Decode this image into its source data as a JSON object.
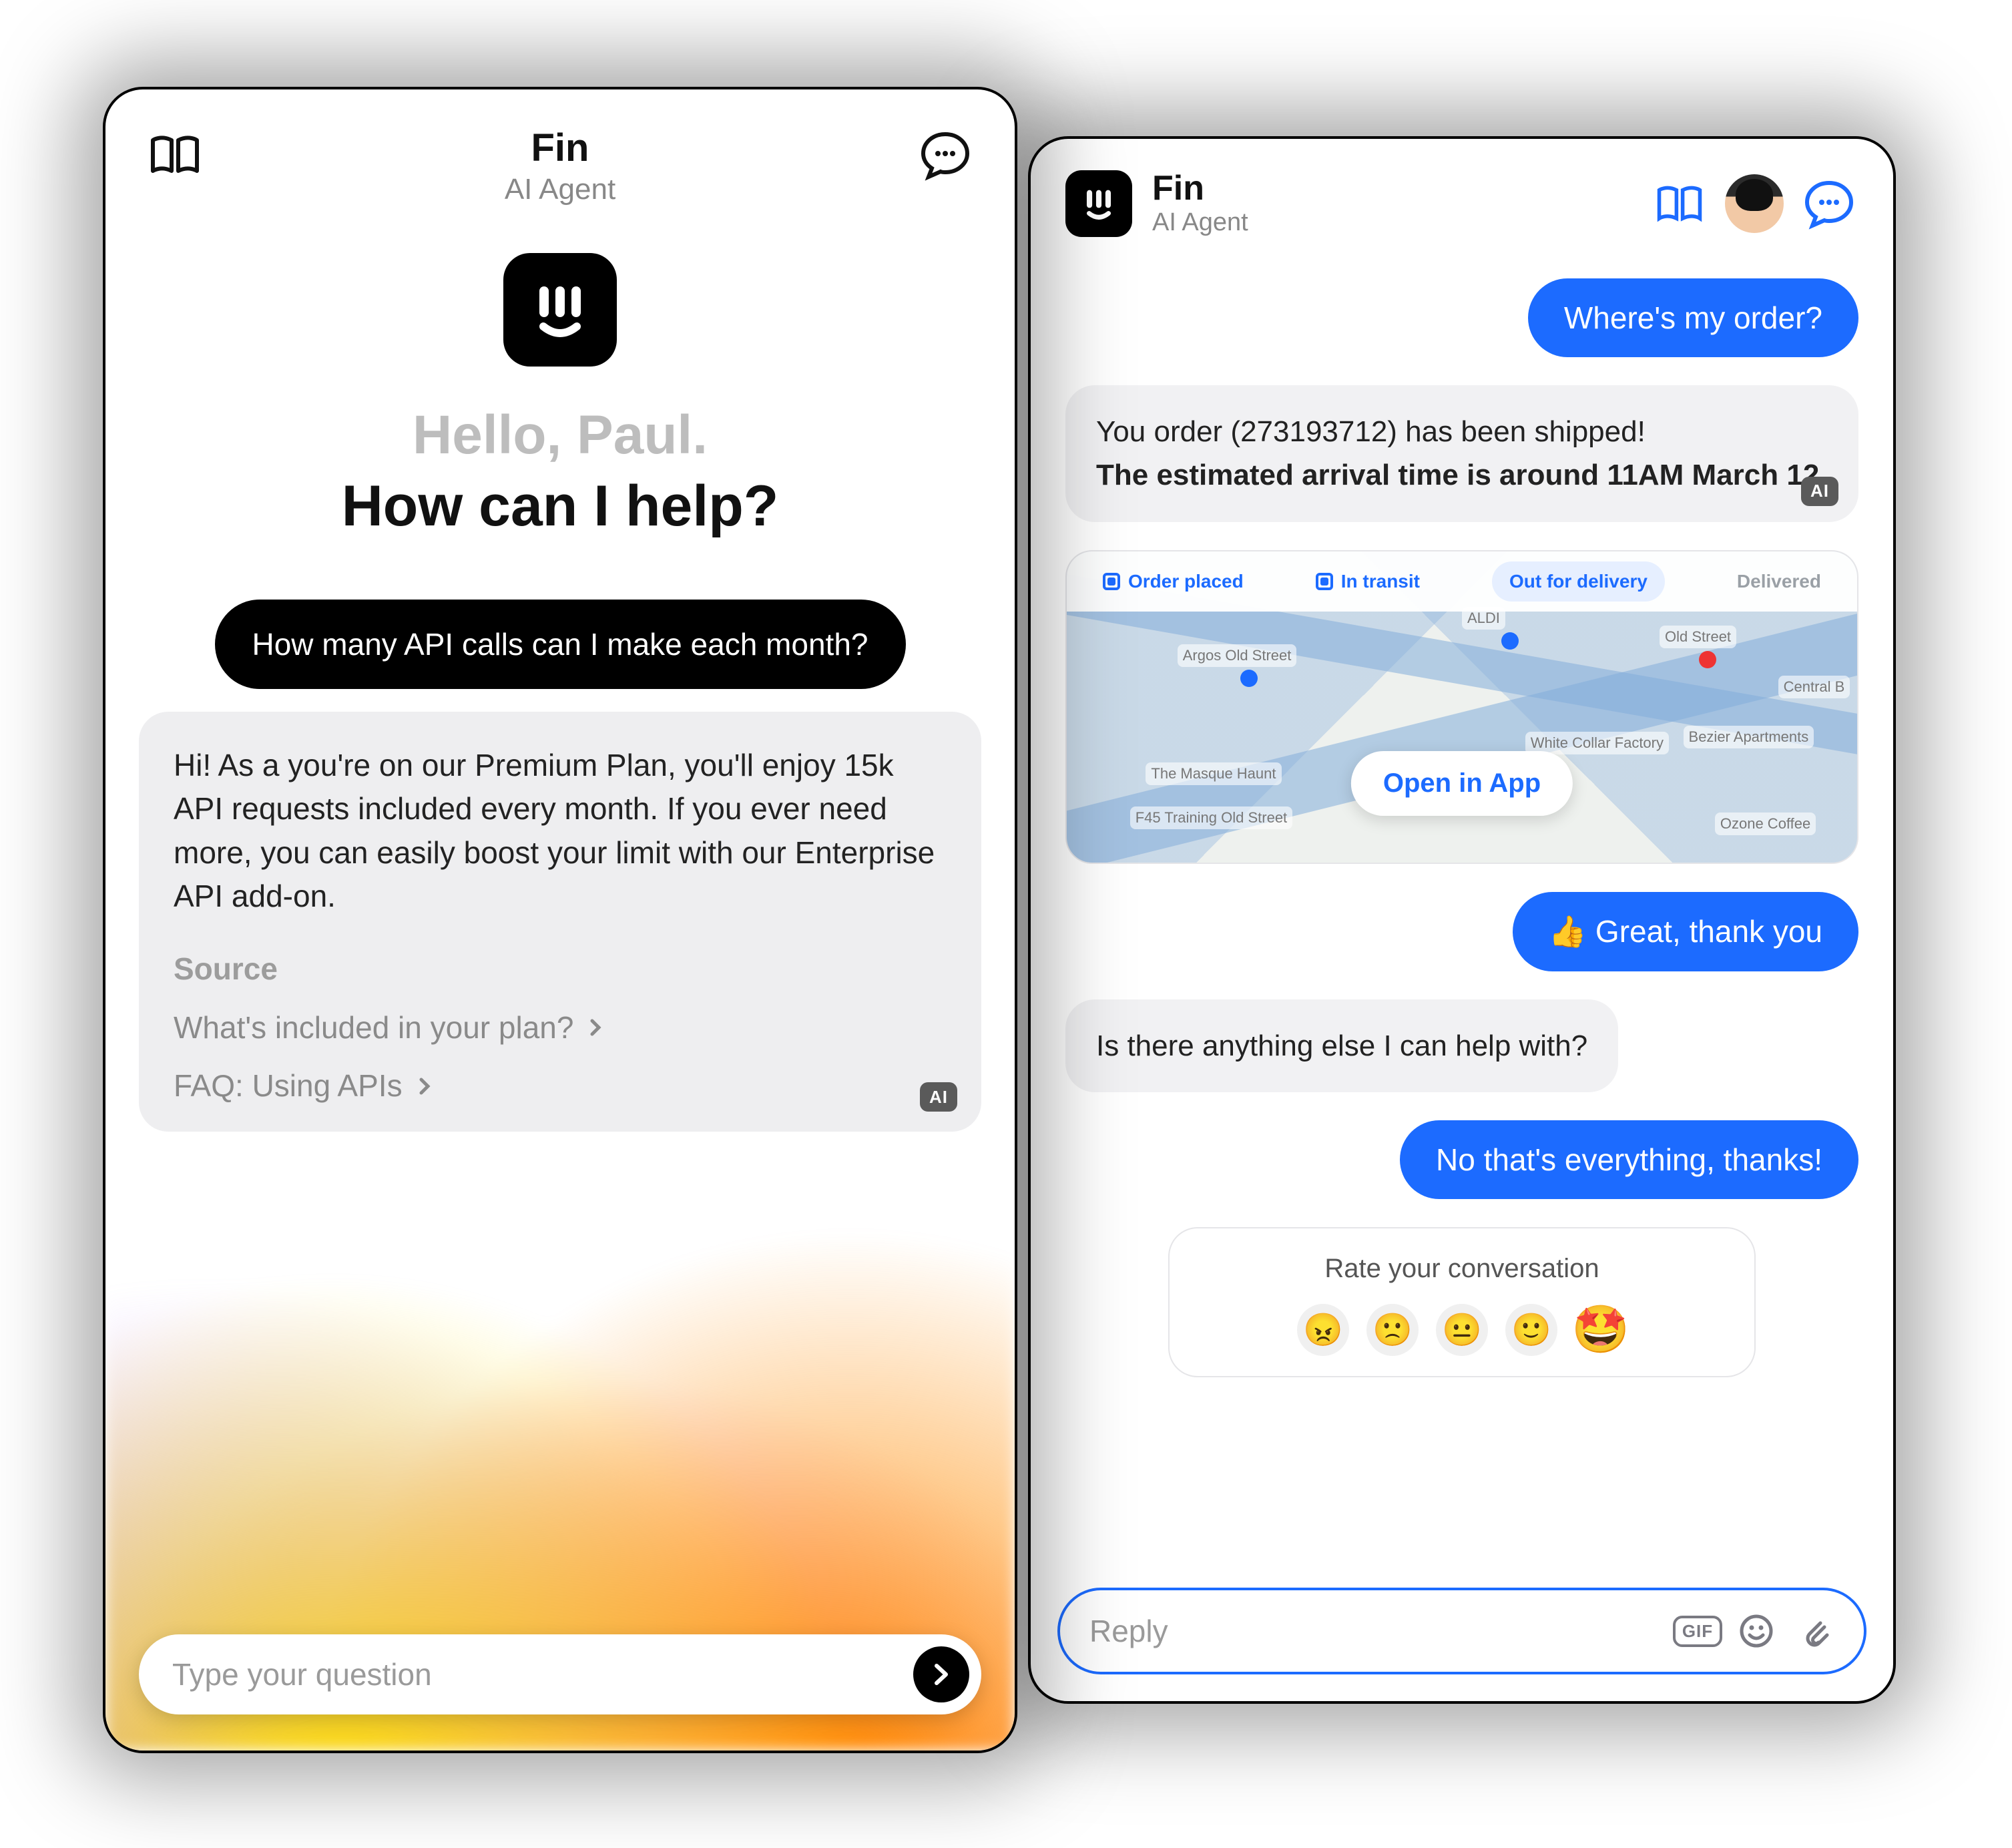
{
  "left": {
    "header": {
      "title": "Fin",
      "subtitle": "AI Agent"
    },
    "hero": {
      "greeting": "Hello, Paul.",
      "prompt": "How can I help?"
    },
    "userChip": "How many API calls can I make each month?",
    "botReply": "Hi! As a you're on our Premium Plan, you'll enjoy 15k API requests included every month. If you ever need more, you can easily boost your limit with our Enterprise API add-on.",
    "sourceHeading": "Source",
    "sources": [
      "What's included in your plan?",
      "FAQ: Using APIs"
    ],
    "aiBadge": "AI",
    "inputPlaceholder": "Type your question"
  },
  "right": {
    "header": {
      "title": "Fin",
      "subtitle": "AI Agent"
    },
    "msgs": {
      "user1": "Where's my order?",
      "bot1_line1": "You order (273193712) has been shipped!",
      "bot1_line2": "The estimated arrival time is around 11AM March 12.",
      "user2": "👍 Great, thank you",
      "bot2": "Is there anything else I can help with?",
      "user3": "No that's everything, thanks!"
    },
    "map": {
      "steps": [
        "Order placed",
        "In transit",
        "Out for delivery",
        "Delivered"
      ],
      "activeIndex": 2,
      "openLabel": "Open in App",
      "labels": [
        "Argos Old Street",
        "ALDI",
        "Old Street",
        "The Masque Haunt",
        "White Collar Factory",
        "Bezier Apartments",
        "Ozone Coffee",
        "F45 Training Old Street",
        "Central B"
      ]
    },
    "rating": {
      "title": "Rate your conversation",
      "faces": [
        "😠",
        "🙁",
        "😐",
        "🙂"
      ],
      "star": "🤩"
    },
    "aiBadge": "AI",
    "replyPlaceholder": "Reply",
    "gif": "GIF"
  }
}
